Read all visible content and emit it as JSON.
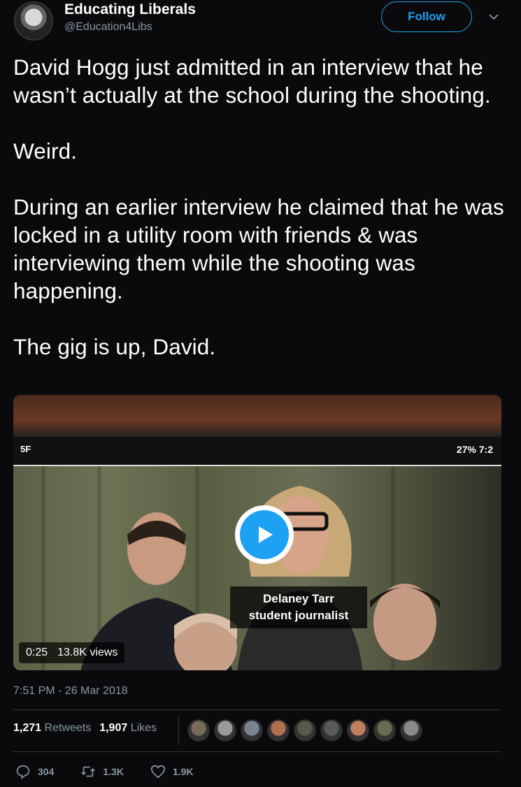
{
  "author": {
    "name": "Educating Liberals",
    "handle": "@Education4Libs",
    "follow_label": "Follow"
  },
  "tweet": {
    "text": "David Hogg just admitted in an interview that he wasn’t actually at the school during the shooting.\n\nWeird.\n\nDuring an earlier interview he claimed that he was locked in a utility room with friends & was interviewing them while the shooting was happening.\n\nThe gig is up, David."
  },
  "video": {
    "caption_name": "Delaney Tarr",
    "caption_role": "student journalist",
    "phone_status_left": "5F",
    "phone_status_right": "27%  7:2",
    "duration": "0:25",
    "views": "13.8K views"
  },
  "meta": {
    "timestamp": "7:51 PM - 26 Mar 2018",
    "retweets_count": "1,271",
    "retweets_label": "Retweets",
    "likes_count": "1,907",
    "likes_label": "Likes"
  },
  "liker_avatars": [
    "#7a6a5a",
    "#9a9a9a",
    "#7a8490",
    "#b07050",
    "#555a4a",
    "#5a5a5a",
    "#c08060",
    "#6a6a50",
    "#8a8a8a"
  ],
  "actions": {
    "replies": "304",
    "retweets": "1.3K",
    "likes": "1.9K"
  },
  "colors": {
    "accent": "#1da1f2",
    "background": "#0a0a0c",
    "muted": "#8899a6"
  }
}
